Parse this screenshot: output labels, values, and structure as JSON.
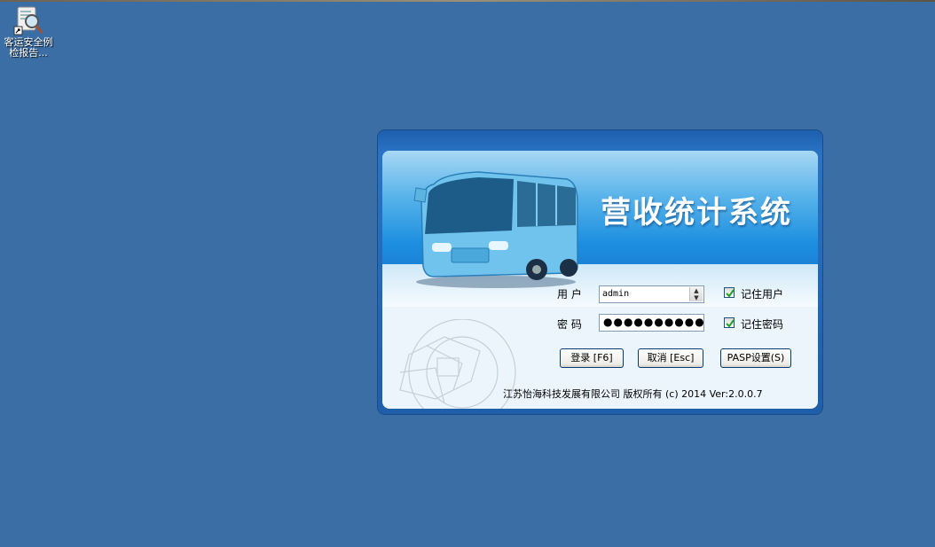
{
  "desktop": {
    "icons": [
      {
        "label_line1": "客运安全例",
        "label_line2": "检报告..."
      }
    ]
  },
  "dialog": {
    "title": "营收统计系统",
    "username_label": "用 户",
    "username_value": "admin",
    "password_label": "密 码",
    "password_value": "●●●●●●●●●●",
    "remember_user_label": "记住用户",
    "remember_user_checked": true,
    "remember_password_label": "记住密码",
    "remember_password_checked": true,
    "login_button": "登录 [F6]",
    "cancel_button": "取消 [Esc]",
    "settings_button": "PASP设置(S)",
    "footer": "江苏怡海科技发展有限公司 版权所有 (c) 2014 Ver:2.0.0.7"
  },
  "colors": {
    "desktop_bg": "#3a6ea5",
    "dialog_frame": "#1f5ea8",
    "banner": "#1d8fe0"
  }
}
